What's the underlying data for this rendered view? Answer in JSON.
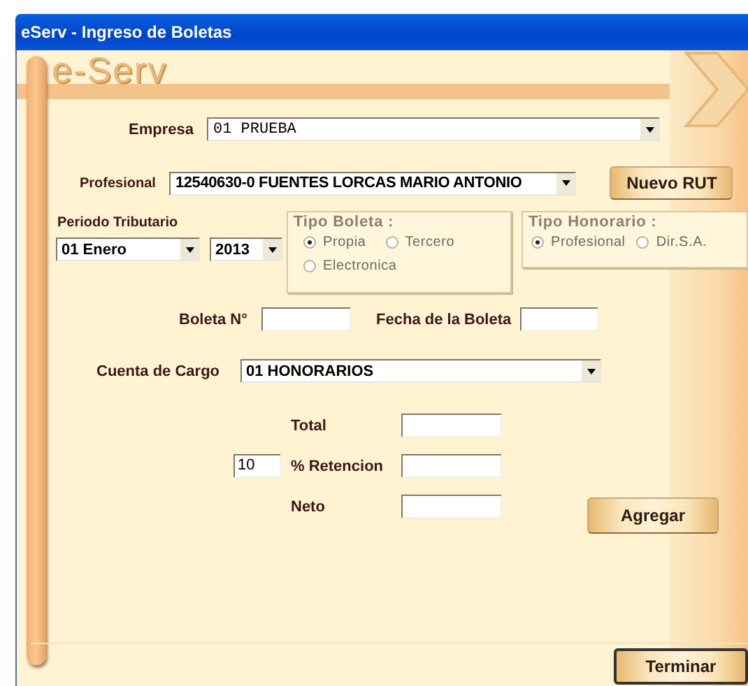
{
  "window": {
    "title": "eServ - Ingreso de Boletas"
  },
  "logo": "e-Serv",
  "empresa": {
    "label": "Empresa",
    "value": "01 PRUEBA"
  },
  "profesional": {
    "label": "Profesional",
    "value": "12540630-0 FUENTES LORCAS MARIO ANTONIO"
  },
  "nuevo_rut_button": "Nuevo RUT",
  "periodo": {
    "label": "Periodo Tributario",
    "month": "01 Enero",
    "year": "2013"
  },
  "tipo_boleta": {
    "title": "Tipo Boleta :",
    "options": [
      {
        "label": "Propia",
        "selected": true
      },
      {
        "label": "Tercero",
        "selected": false
      },
      {
        "label": "Electronica",
        "selected": false
      }
    ]
  },
  "tipo_honorario": {
    "title": "Tipo Honorario :",
    "options": [
      {
        "label": "Profesional",
        "selected": true
      },
      {
        "label": "Dir.S.A.",
        "selected": false
      }
    ]
  },
  "boleta_numero": {
    "label": "Boleta N°"
  },
  "fecha_boleta": {
    "label": "Fecha de la Boleta"
  },
  "cuenta_cargo": {
    "label": "Cuenta de Cargo",
    "value": "01 HONORARIOS"
  },
  "total": {
    "label": "Total"
  },
  "retencion": {
    "label": "% Retencion",
    "rate": "10"
  },
  "neto": {
    "label": "Neto"
  },
  "agregar_button": "Agregar",
  "terminar_button": "Terminar"
}
